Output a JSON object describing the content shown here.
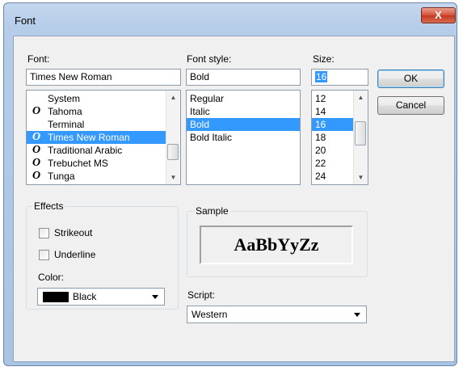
{
  "window": {
    "title": "Font",
    "close_glyph": "X"
  },
  "font": {
    "label": "Font:",
    "value": "Times New Roman",
    "items": [
      {
        "name": "System",
        "icon": ""
      },
      {
        "name": "Tahoma",
        "icon": "O"
      },
      {
        "name": "Terminal",
        "icon": ""
      },
      {
        "name": "Times New Roman",
        "icon": "O"
      },
      {
        "name": "Traditional Arabic",
        "icon": "O"
      },
      {
        "name": "Trebuchet MS",
        "icon": "O"
      },
      {
        "name": "Tunga",
        "icon": "O"
      }
    ],
    "selected": "Times New Roman"
  },
  "style": {
    "label": "Font style:",
    "value": "Bold",
    "items": [
      "Regular",
      "Italic",
      "Bold",
      "Bold Italic"
    ],
    "selected": "Bold"
  },
  "size": {
    "label": "Size:",
    "value": "16",
    "items": [
      "12",
      "14",
      "16",
      "18",
      "20",
      "22",
      "24"
    ],
    "selected": "16"
  },
  "buttons": {
    "ok": "OK",
    "cancel": "Cancel"
  },
  "effects": {
    "legend": "Effects",
    "strikeout": {
      "label": "Strikeout",
      "checked": false
    },
    "underline": {
      "label": "Underline",
      "checked": false
    },
    "color_label": "Color:",
    "color": {
      "name": "Black",
      "swatch": "#000000"
    }
  },
  "sample": {
    "legend": "Sample",
    "text": "AaBbYyZz"
  },
  "script": {
    "label": "Script:",
    "value": "Western"
  },
  "colors": {
    "selection": "#3399ff",
    "title_bar": "#b6cde9",
    "dialog_bg": "#f0f0f0",
    "close_red": "#d4553b"
  },
  "icons": {
    "font_type": "truetype-icon",
    "scroll_up": "scroll-up-icon",
    "scroll_down": "scroll-down-icon",
    "dropdown": "chevron-down-icon",
    "close": "close-icon"
  }
}
